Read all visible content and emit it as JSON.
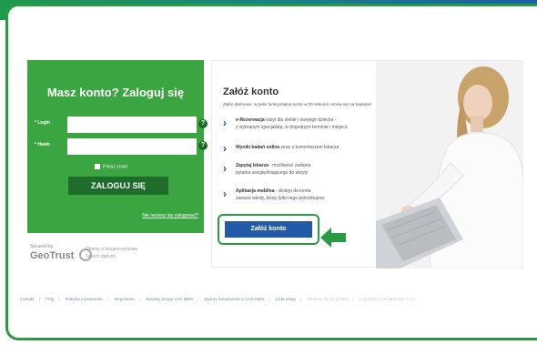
{
  "login": {
    "title": "Masz konto? Zaloguj się",
    "login_label": "* Login",
    "password_label": "* Hasło",
    "login_value": "",
    "password_value": "",
    "show_password": "Pokaż znaki",
    "submit": "ZALOGUJ SIĘ",
    "forgot": "Nie możesz się zalogować?",
    "help_glyph": "?"
  },
  "security": {
    "secured_by": "Secured by",
    "brand": "GeoTrust",
    "note": "Dbamy o bezpieczeństwo Twoich danych."
  },
  "register": {
    "title": "Załóż konto",
    "subtitle": "Załóż darmowe, w pełni funkcjonalne konto w 30 sekund i umów się na badanie!",
    "features": [
      {
        "bold": "e-Rezerwacja",
        "text": " wizyt dla siebie i swojego dziecka -",
        "line2": "z wybranym specjalistą, w dogodnym terminie i miejscu"
      },
      {
        "bold": "Wyniki badań online",
        "text": " wraz z komentarzem lekarza",
        "line2": ""
      },
      {
        "bold": "Zapytaj lekarza",
        "text": " - możliwość zadania",
        "line2": "pytania uwzględniającego do wizyty"
      },
      {
        "bold": "Aplikacja mobilna",
        "text": " - dostęp do konta",
        "line2": "zawsze wtedy, kiedy tylko tego potrzebujesz"
      }
    ],
    "button": "Załóż konto",
    "chevron": "›"
  },
  "footer": {
    "links": [
      "Kontakt",
      "FAQ",
      "Polityka prywatności",
      "Regulamin",
      "Serwisy Grupy LUX MED",
      "Dyżury świadczone w LUX MED",
      "Lista usług"
    ],
    "version": "Infolinia: 22 33 22 888",
    "copyright": "Copyright LUX MED Sp. z o.o."
  },
  "colors": {
    "green": "#3aa541",
    "dark_green": "#1f6d2a",
    "blue_button": "#235aa8",
    "highlight": "#2a9a44"
  }
}
